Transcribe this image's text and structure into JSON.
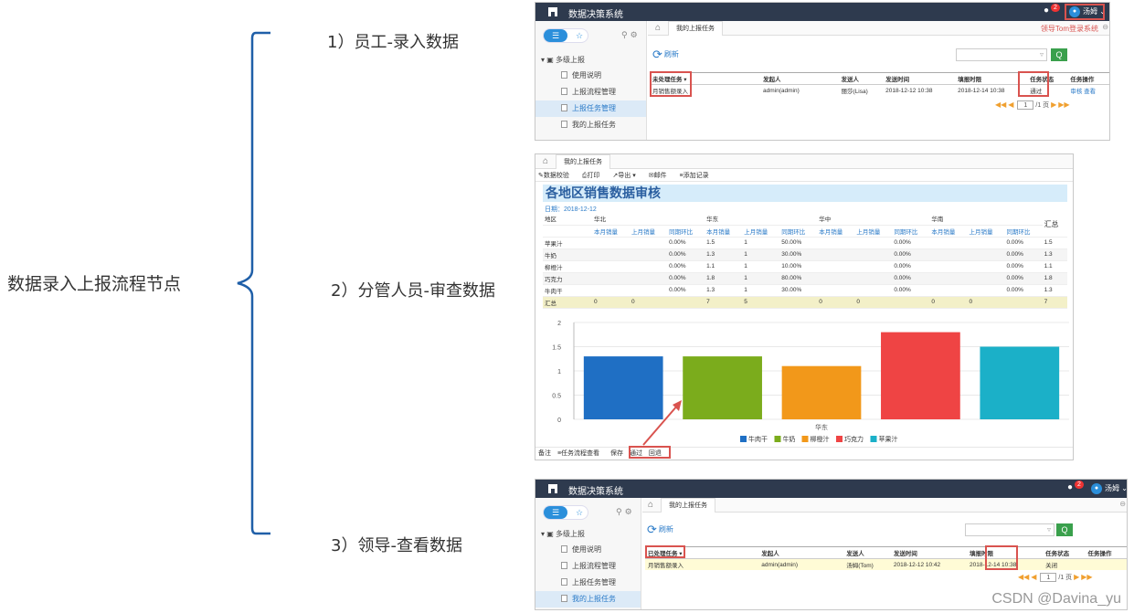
{
  "left_title": "数据录入上报流程节点",
  "steps": [
    "1）员工-录入数据",
    "2）分管人员-审查数据",
    "3）领导-查看数据"
  ],
  "watermark": "CSDN @Davina_yu",
  "app": {
    "title": "数据决策系统",
    "sidebar": {
      "root": "多级上报",
      "items": [
        "使用说明",
        "上报流程管理",
        "上报任务管理",
        "我的上报任务"
      ]
    },
    "tab": "我的上报任务",
    "refresh": "刷新",
    "search_btn": "Q",
    "page_current": "1",
    "page_total": "/1 页"
  },
  "panel1": {
    "user": "汤姆",
    "badge": "2",
    "login_note": "领导Tom登录系统",
    "headers": [
      "未处理任务 ▾",
      "发起人",
      "发送人",
      "发送时间",
      "填报时限",
      "任务状态",
      "任务操作"
    ],
    "row": [
      "月销售额录入",
      "admin(admin)",
      "丽莎(Lisa)",
      "2018-12-12 10:38",
      "2018-12-14 10:38",
      "通过",
      "审核",
      "查看"
    ]
  },
  "panel2": {
    "tab": "我的上报任务",
    "toolbar": [
      "数据校验",
      "打印",
      "导出 ▾",
      "邮件",
      "添加记录"
    ],
    "report_title": "各地区销售数据审核",
    "date": "日期：2018-12-12",
    "region_label": "地区",
    "regions": [
      "华北",
      "华东",
      "华中",
      "华南"
    ],
    "total_label": "汇总",
    "subheads": [
      "本月销量",
      "上月销量",
      "同期环比"
    ],
    "rows": [
      {
        "name": "苹果汁",
        "c": [
          "",
          "",
          "0.00%",
          "1.5",
          "1",
          "50.00%",
          "",
          "",
          "0.00%",
          "",
          "",
          "0.00%",
          "1.5"
        ]
      },
      {
        "name": "牛奶",
        "c": [
          "",
          "",
          "0.00%",
          "1.3",
          "1",
          "30.00%",
          "",
          "",
          "0.00%",
          "",
          "",
          "0.00%",
          "1.3"
        ]
      },
      {
        "name": "柳橙汁",
        "c": [
          "",
          "",
          "0.00%",
          "1.1",
          "1",
          "10.00%",
          "",
          "",
          "0.00%",
          "",
          "",
          "0.00%",
          "1.1"
        ]
      },
      {
        "name": "巧克力",
        "c": [
          "",
          "",
          "0.00%",
          "1.8",
          "1",
          "80.00%",
          "",
          "",
          "0.00%",
          "",
          "",
          "0.00%",
          "1.8"
        ]
      },
      {
        "name": "牛肉干",
        "c": [
          "",
          "",
          "0.00%",
          "1.3",
          "1",
          "30.00%",
          "",
          "",
          "0.00%",
          "",
          "",
          "0.00%",
          "1.3"
        ]
      }
    ],
    "total_row": {
      "name": "汇总",
      "c": [
        "0",
        "0",
        "",
        "7",
        "5",
        "",
        "0",
        "0",
        "",
        "0",
        "0",
        "",
        "7"
      ]
    },
    "bottombar": [
      "备注",
      "任务流程查看",
      "保存",
      "通过",
      "回退"
    ]
  },
  "chart_data": {
    "type": "bar",
    "categories": [
      "华东"
    ],
    "series": [
      {
        "name": "牛肉干",
        "values": [
          1.3
        ]
      },
      {
        "name": "牛奶",
        "values": [
          1.3
        ]
      },
      {
        "name": "柳橙汁",
        "values": [
          1.1
        ]
      },
      {
        "name": "巧克力",
        "values": [
          1.8
        ]
      },
      {
        "name": "苹果汁",
        "values": [
          1.5
        ]
      }
    ],
    "colors": [
      "#1f6fc4",
      "#7bac1c",
      "#f2981a",
      "#ef4444",
      "#1bb0c8"
    ],
    "ylim": [
      0,
      2
    ],
    "yticks": [
      "0",
      "0.5",
      "1",
      "1.5",
      "2"
    ],
    "legend": "bottom",
    "grid": true
  },
  "panel3": {
    "user": "汤姆",
    "badge": "2",
    "headers": [
      "已处理任务 ▾",
      "发起人",
      "发送人",
      "发送时间",
      "填报时限",
      "任务状态",
      "任务操作"
    ],
    "row": [
      "月销售额录入",
      "admin(admin)",
      "汤姆(Tom)",
      "2018-12-12 10:42",
      "2018-12-14 10:38",
      "关闭",
      ""
    ]
  }
}
